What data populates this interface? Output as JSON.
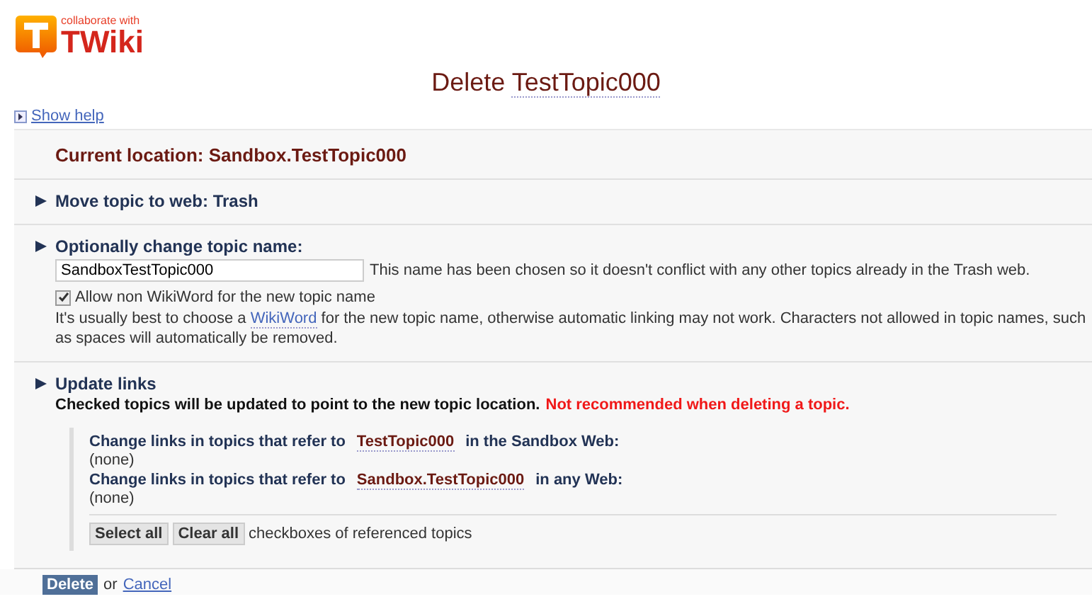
{
  "logo": {
    "tagline": "collaborate with",
    "name": "TWiki"
  },
  "title": {
    "action": "Delete",
    "topic": "TestTopic000"
  },
  "help_link": "Show help",
  "current_location": "Current location: Sandbox.TestTopic000",
  "move_section": {
    "heading": "Move topic to web: Trash"
  },
  "rename_section": {
    "heading": "Optionally change topic name:",
    "value": "SandboxTestTopic000",
    "note": "This name has been chosen so it doesn't conflict with any other topics already in the Trash web.",
    "allow_checkbox": {
      "label": "Allow non WikiWord for the new topic name",
      "checked": true
    },
    "hint_before": "It's usually best to choose a",
    "hint_link": "WikiWord",
    "hint_after": "for the new topic name, otherwise automatic linking may not work. Characters not allowed in topic names, such as spaces will automatically be removed."
  },
  "links_section": {
    "heading": "Update links",
    "info": "Checked topics will be updated to point to the new topic location.",
    "warning": "Not recommended when deleting a topic.",
    "groups": [
      {
        "before": "Change links in topics that refer to",
        "topic": "TestTopic000",
        "after": "in the Sandbox Web:",
        "result": "(none)"
      },
      {
        "before": "Change links in topics that refer to",
        "topic": "Sandbox.TestTopic000",
        "after": "in any Web:",
        "result": "(none)"
      }
    ],
    "buttons": [
      "Select all",
      "Clear all"
    ],
    "buttons_note": "checkboxes of referenced topics"
  },
  "footer": {
    "submit": "Delete",
    "or": "or",
    "cancel": "Cancel"
  }
}
